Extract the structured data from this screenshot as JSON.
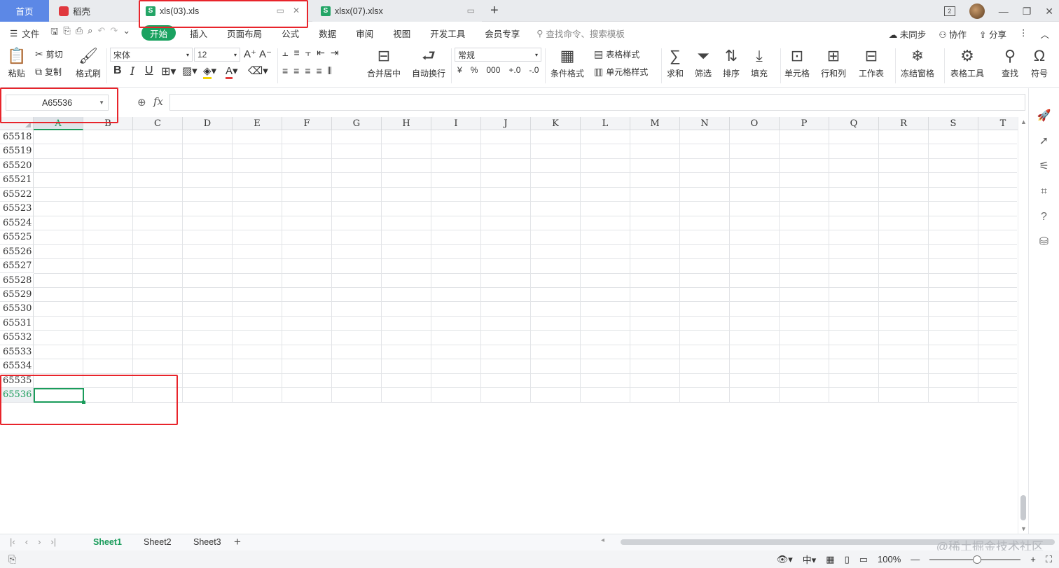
{
  "tabs": {
    "home": "首页",
    "daoke": "稻壳",
    "file1": "xls(03).xls",
    "file2": "xlsx(07).xlsx",
    "add": "+",
    "pages_badge": "2"
  },
  "menu": {
    "file": "文件",
    "tabs": [
      "开始",
      "插入",
      "页面布局",
      "公式",
      "数据",
      "审阅",
      "视图",
      "开发工具",
      "会员专享"
    ],
    "search_placeholder": "查找命令、搜索模板",
    "sync": "未同步",
    "collab": "协作",
    "share": "分享"
  },
  "ribbon": {
    "paste": "粘贴",
    "cut": "剪切",
    "copy": "复制",
    "format_painter": "格式刷",
    "font_name": "宋体",
    "font_size": "12",
    "bold": "B",
    "italic": "I",
    "underline": "U",
    "merge_center": "合并居中",
    "wrap_text": "自动换行",
    "number_format": "常规",
    "currency": "¥",
    "percent": "%",
    "thousands": "000",
    "decimal_inc": "+.0",
    "decimal_dec": "-.0",
    "cond_format": "条件格式",
    "table_style": "表格样式",
    "cell_style": "单元格样式",
    "sum": "求和",
    "filter": "筛选",
    "sort": "排序",
    "fill": "填充",
    "cell": "单元格",
    "rowcol": "行和列",
    "worksheet": "工作表",
    "freeze": "冻结窗格",
    "table_tools": "表格工具",
    "find": "查找",
    "symbol": "符号"
  },
  "formula": {
    "name_box": "A65536",
    "fx": "fx",
    "value": ""
  },
  "grid": {
    "columns": [
      "A",
      "B",
      "C",
      "D",
      "E",
      "F",
      "G",
      "H",
      "I",
      "J",
      "K",
      "L",
      "M",
      "N",
      "O",
      "P",
      "Q",
      "R",
      "S",
      "T"
    ],
    "rows": [
      "65518",
      "65519",
      "65520",
      "65521",
      "65522",
      "65523",
      "65524",
      "65525",
      "65526",
      "65527",
      "65528",
      "65529",
      "65530",
      "65531",
      "65532",
      "65533",
      "65534",
      "65535",
      "65536"
    ],
    "active_row": "65536",
    "active_col": "A"
  },
  "sheets": [
    "Sheet1",
    "Sheet2",
    "Sheet3"
  ],
  "active_sheet": "Sheet1",
  "status": {
    "zoom": "100%"
  },
  "watermark": "@稀土掘金技术社区",
  "colors": {
    "accent": "#1a9c5b",
    "home_tab": "#5c88e6",
    "annotation": "#e8242b"
  }
}
